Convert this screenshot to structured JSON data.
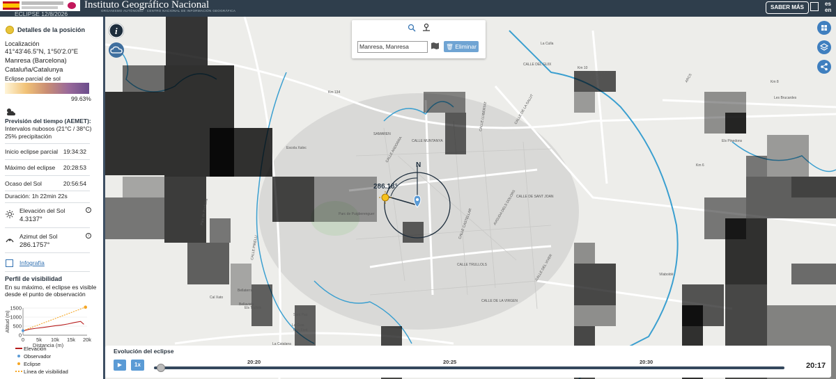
{
  "header": {
    "eclipse_date": "ECLIPSE 12/8/2026",
    "ign_title": "Instituto Geográfico Nacional",
    "ign_subtitle": "ORGANISMO AUTÓNOMO · CENTRO NACIONAL DE INFORMACIÓN GEOGRÁFICA",
    "saber_mas": "SABER MÁS",
    "lang_es": "es",
    "lang_en": "en"
  },
  "sidebar": {
    "title": "Detalles de la posición",
    "loc_label": "Localización",
    "coords": "41°43'46.5\"N, 1°50'2.0\"E",
    "town": "Manresa (Barcelona)",
    "region": "Cataluña/Catalunya",
    "eclipse_type": "Eclipse parcial de sol",
    "percent": "99.63%",
    "weather_title": "Previsión del tiempo (AEMET):",
    "weather_line1": "Intervalos nubosos (21°C / 38°C)",
    "weather_line2": "25% precipitación",
    "rows": [
      {
        "label": "Inicio eclipse parcial",
        "value": "19:34:32"
      },
      {
        "label": "Máximo del eclipse",
        "value": "20:28:53"
      },
      {
        "label": "Ocaso del Sol",
        "value": "20:56:54"
      }
    ],
    "duration": "Duración: 1h 22min 22s",
    "elev_label": "Elevación del Sol",
    "elev_value": "4.3137°",
    "azim_label": "Azimut del Sol",
    "azim_value": "286.1757°",
    "infografia": "Infografía",
    "profile_title": "Perfil de visibilidad",
    "profile_desc1": "En su máximo, el eclipse es visible",
    "profile_desc2": "desde el punto de observación",
    "legend": {
      "elevacion": "Elevación",
      "observador": "Observador",
      "eclipse": "Eclipse",
      "linea": "Línea de visibilidad"
    }
  },
  "chart_data": {
    "type": "line",
    "title": "",
    "xlabel": "Distancia (m)",
    "ylabel": "Altitud (m)",
    "x_ticks": [
      "0",
      "5k",
      "10k",
      "15k",
      "20k"
    ],
    "y_ticks": [
      "0",
      "500",
      "1000",
      "1500"
    ],
    "xlim": [
      0,
      20000
    ],
    "ylim": [
      0,
      1500
    ],
    "series": [
      {
        "name": "Elevación",
        "color": "#b71c1c",
        "x": [
          0,
          2000,
          4000,
          6000,
          8000,
          10000,
          12000,
          14000,
          16000,
          18000,
          19000
        ],
        "y": [
          230,
          330,
          380,
          420,
          470,
          520,
          560,
          620,
          700,
          760,
          600
        ]
      },
      {
        "name": "Línea de visibilidad",
        "color": "#f5a623",
        "x": [
          0,
          19500
        ],
        "y": [
          250,
          1550
        ]
      }
    ],
    "observer": {
      "x": 0,
      "y": 250,
      "color": "#5b9bd5"
    },
    "eclipse_point": {
      "x": 19500,
      "y": 1550,
      "color": "#f5a623"
    }
  },
  "map": {
    "search_value": "Manresa, Manresa",
    "eliminar": "Eliminar",
    "azimuth_label": "286.18°",
    "north": "N",
    "streets": [
      "CALLE DEL GUIX",
      "CALLE LLIBERTAT",
      "CALLE DE LA SALUT",
      "CALLE PIRELLI",
      "CALLE DE SANT JOAN",
      "CALLE MUNTANYA",
      "CALLE CASTELLAR",
      "CALLE TRULLOLS",
      "CALLE DEL VIVER",
      "CALLE DE LA VIRGEN",
      "ARCS",
      "LA FLORESTA",
      "BAGES",
      "Els Trullols",
      "Bellavista",
      "Bellaterra",
      "Les Brucardes",
      "Els Pinedons",
      "Vilaboldé",
      "La Catalana",
      "Sant Pau",
      "La Guia",
      "Can Font",
      "Parc de Puigberenguer",
      "AVGUDA DELS DOLORS",
      "Escola Xaloc",
      "Cal Xato",
      "Parc de Prodiana",
      "Km 134",
      "Km 8",
      "Km 6",
      "Km 10",
      "La Culla",
      "SAMAREN",
      "CALLE ANDORRA"
    ]
  },
  "timeline": {
    "title": "Evolución del eclipse",
    "speed": "1x",
    "ticks": [
      "20:20",
      "20:25",
      "20:30"
    ],
    "current_time": "20:17",
    "progress": 0.01
  }
}
